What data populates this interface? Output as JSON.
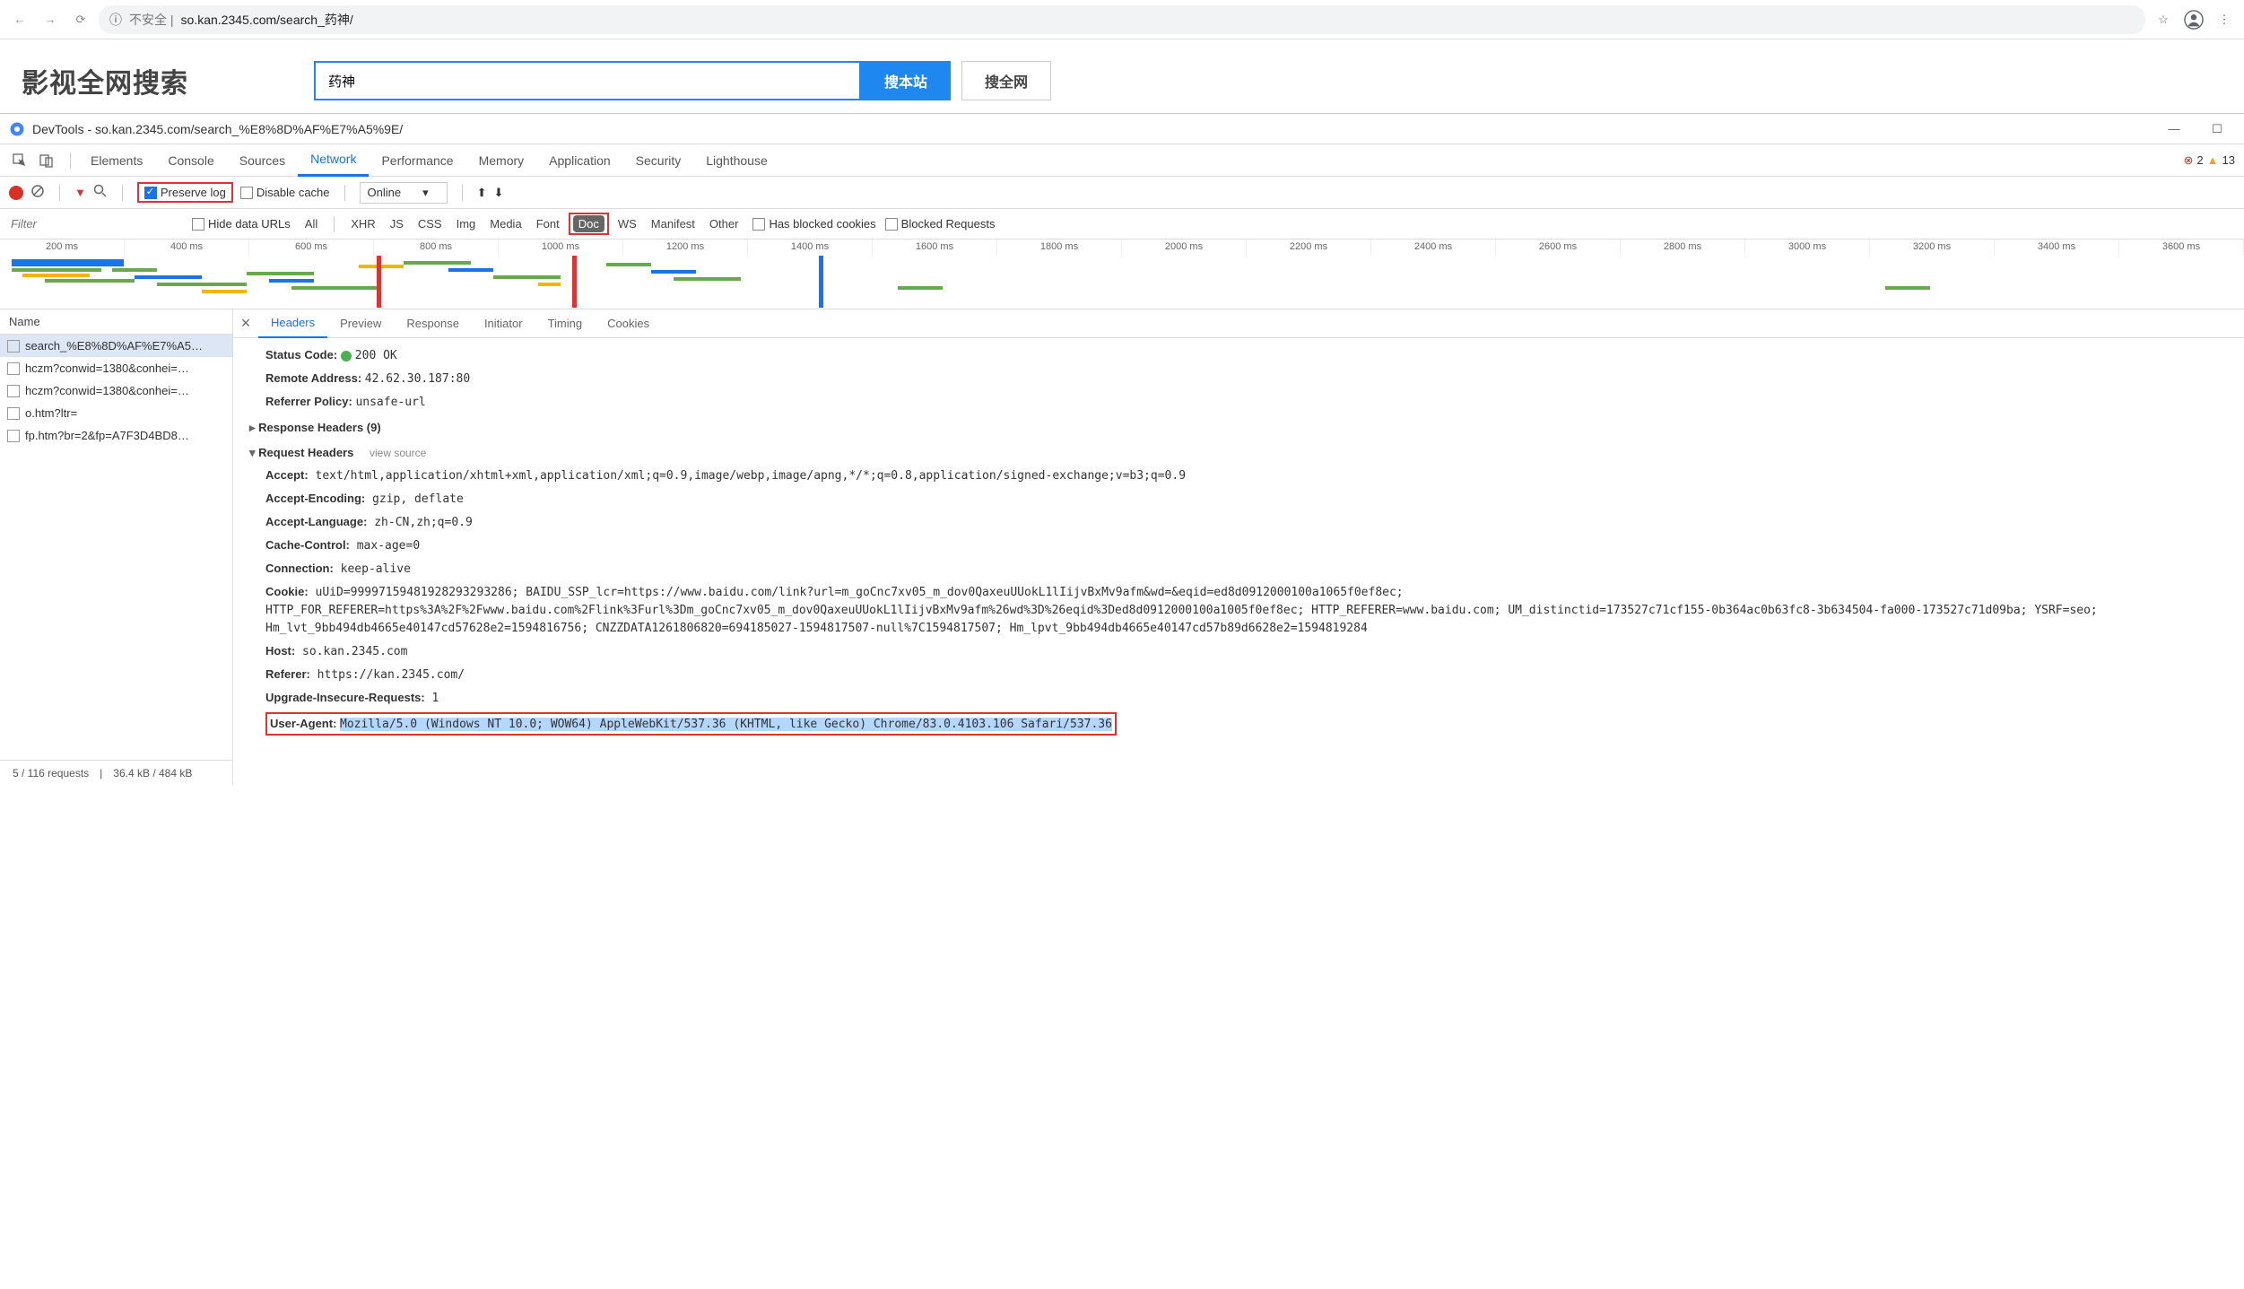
{
  "browser": {
    "url_prefix": "不安全 | ",
    "url": "so.kan.2345.com/search_药神/"
  },
  "page": {
    "logo": "影视全网搜索",
    "search_value": "药神",
    "btn_local": "搜本站",
    "btn_global": "搜全网"
  },
  "devtools": {
    "title": "DevTools - so.kan.2345.com/search_%E8%8D%AF%E7%A5%9E/",
    "tabs": [
      "Elements",
      "Console",
      "Sources",
      "Network",
      "Performance",
      "Memory",
      "Application",
      "Security",
      "Lighthouse"
    ],
    "active_tab": "Network",
    "errors": "2",
    "warnings": "13"
  },
  "toolbar": {
    "preserve_log": "Preserve log",
    "disable_cache": "Disable cache",
    "throttle": "Online"
  },
  "filter": {
    "placeholder": "Filter",
    "hide_data_urls": "Hide data URLs",
    "types": [
      "All",
      "XHR",
      "JS",
      "CSS",
      "Img",
      "Media",
      "Font",
      "Doc",
      "WS",
      "Manifest",
      "Other"
    ],
    "active_type": "Doc",
    "has_blocked": "Has blocked cookies",
    "blocked_req": "Blocked Requests"
  },
  "timeline_ticks": [
    "200 ms",
    "400 ms",
    "600 ms",
    "800 ms",
    "1000 ms",
    "1200 ms",
    "1400 ms",
    "1600 ms",
    "1800 ms",
    "2000 ms",
    "2200 ms",
    "2400 ms",
    "2600 ms",
    "2800 ms",
    "3000 ms",
    "3200 ms",
    "3400 ms",
    "3600 ms"
  ],
  "requests": {
    "header": "Name",
    "items": [
      "search_%E8%8D%AF%E7%A5…",
      "hczm?conwid=1380&conhei=…",
      "hczm?conwid=1380&conhei=…",
      "o.htm?ltr=",
      "fp.htm?br=2&fp=A7F3D4BD8…"
    ],
    "status": {
      "count": "5 / 116 requests",
      "size": "36.4 kB / 484 kB"
    }
  },
  "detail_tabs": [
    "Headers",
    "Preview",
    "Response",
    "Initiator",
    "Timing",
    "Cookies"
  ],
  "headers": {
    "status_code": {
      "key": "Status Code:",
      "val": "200 OK"
    },
    "remote": {
      "key": "Remote Address:",
      "val": "42.62.30.187:80"
    },
    "referrer_policy": {
      "key": "Referrer Policy:",
      "val": "unsafe-url"
    },
    "response_section": "Response Headers (9)",
    "request_section": "Request Headers",
    "view_source": "view source",
    "rows": [
      {
        "key": "Accept:",
        "val": "text/html,application/xhtml+xml,application/xml;q=0.9,image/webp,image/apng,*/*;q=0.8,application/signed-exchange;v=b3;q=0.9"
      },
      {
        "key": "Accept-Encoding:",
        "val": "gzip, deflate"
      },
      {
        "key": "Accept-Language:",
        "val": "zh-CN,zh;q=0.9"
      },
      {
        "key": "Cache-Control:",
        "val": "max-age=0"
      },
      {
        "key": "Connection:",
        "val": "keep-alive"
      },
      {
        "key": "Cookie:",
        "val": "uUiD=9999715948192829329328​6; BAIDU_SSP_lcr=https://www.baidu.com/link?url=m_goCnc7xv05_m_dov0QaxeuUUokL1lIijvBxMv9afm&wd=&eqid=ed8d0912000100a1065f0ef8ec; HTTP_FOR_REFERER=https%3A%2F%2Fwww.baidu.com%2Flink%3Furl%3Dm_goCnc7xv05_m_dov0QaxeuUUokL1lIijvBxMv9afm%26wd%3D%26eqid%3Ded8d0912000100a1005f0ef8ec; HTTP_REFERER=www.baidu.com; UM_distinctid=173527c71cf155-0b364ac0b63fc8-3b634504-fa000-173527c71d09ba; YSRF=seo; Hm_lvt_9bb494db4665e40147cd57628e2=1594816756; CNZZDATA1261806820=694185027-1594817507-null%7C1594817507; Hm_lpvt_9bb494db4665e40147cd57b89d6628e2=1594819284"
      },
      {
        "key": "Host:",
        "val": "so.kan.2345.com"
      },
      {
        "key": "Referer:",
        "val": "https://kan.2345.com/"
      },
      {
        "key": "Upgrade-Insecure-Requests:",
        "val": "1"
      }
    ],
    "ua": {
      "key": "User-Agent:",
      "val": "Mozilla/5.0 (Windows NT 10.0; WOW64) AppleWebKit/537.36 (KHTML, like Gecko) Chrome/83.0.4103.106 Safari/537.36"
    }
  }
}
